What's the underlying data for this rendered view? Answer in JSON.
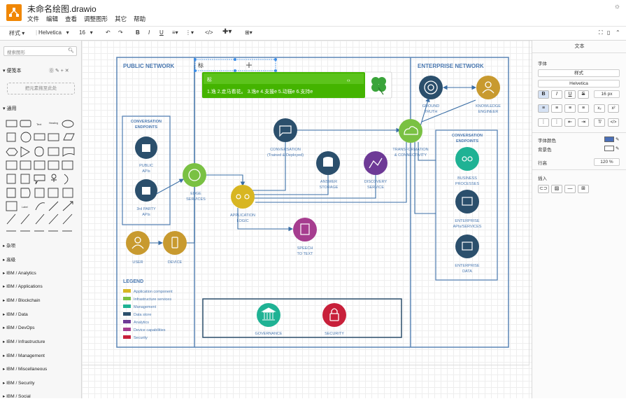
{
  "window": {
    "title": "未命名绘图.drawio",
    "menu": [
      "文件",
      "编辑",
      "查看",
      "调整图形",
      "其它",
      "帮助"
    ]
  },
  "toolbar": {
    "style_label": "样式",
    "font": "Helvetica",
    "size": "16"
  },
  "sidebar": {
    "search_placeholder": "搜索图形",
    "scratchpad_title": "便笺本",
    "scratchpad_drop": "把元素拖至此处",
    "general_title": "通用",
    "libraries": [
      "杂项",
      "高级",
      "IBM / Analytics",
      "IBM / Applications",
      "IBM / Blockchain",
      "IBM / Data",
      "IBM / DevOps",
      "IBM / Infrastructure",
      "IBM / Management",
      "IBM / Miscellaneous",
      "IBM / Security",
      "IBM / Social"
    ]
  },
  "diagram": {
    "public_network": "PUBLIC NETWORK",
    "enterprise_network": "ENTERPRISE NETWORK",
    "editing_text": "标",
    "tooltip_head": "标",
    "tooltip_body": "1.逸 2.走马看花。 3.逸e 4.支援e 5.动猫e 6.支持e",
    "conv_endpoints": [
      "CONVERSATION",
      "ENDPOINTS"
    ],
    "public_apis": [
      "PUBLIC",
      "APIs"
    ],
    "third_party_apis": [
      "3rd PARTY",
      "APIs"
    ],
    "edge_services": [
      "EDGE",
      "SERVICES"
    ],
    "user": "USER",
    "device": "DEVICE",
    "conversation": [
      "CONVERSATION",
      "(Trained & Deployed)"
    ],
    "answer_storage": [
      "ANSWER",
      "STORAGE"
    ],
    "discovery_service": [
      "DISCOVERY",
      "SERVICE"
    ],
    "application_logic": [
      "APPLICATION",
      "LOGIC"
    ],
    "speech_to_text": [
      "SPEECH",
      "TO TEXT"
    ],
    "transformation": [
      "TRANSFORMATION",
      "& CONNECTIVITY"
    ],
    "ground_truth": [
      "GROUND",
      "TRUTH"
    ],
    "knowledge_engineer": [
      "KNOWLEDGE",
      "ENGINEER"
    ],
    "ent_conv_endpoints": [
      "CONVERSATION",
      "ENDPOINTS"
    ],
    "business_processes": [
      "BUSINESS",
      "PROCESSES"
    ],
    "enterprise_apis": [
      "ENTERPRISE",
      "APIs/SERVICES"
    ],
    "enterprise_data": [
      "ENTERPRISE",
      "DATA"
    ],
    "governance": "GOVERNANCE",
    "security": "SECURITY",
    "legend_title": "LEGEND",
    "legend": [
      {
        "label": "Application component",
        "color": "#d8b622"
      },
      {
        "label": "Infrastructure services",
        "color": "#7ac143"
      },
      {
        "label": "Management",
        "color": "#1fb294"
      },
      {
        "label": "Data store",
        "color": "#2b4f6c"
      },
      {
        "label": "Analytics",
        "color": "#6e3a96"
      },
      {
        "label": "Device capabilities",
        "color": "#a63d8f"
      },
      {
        "label": "Security",
        "color": "#c8203a"
      }
    ]
  },
  "right_panel": {
    "tab": "文本",
    "font_label": "字体",
    "style_select": "样式",
    "font_select": "Helvetica",
    "font_size": "16 px",
    "font_color_label": "字体颜色",
    "bg_color_label": "背景色",
    "line_height_label": "行高",
    "line_height": "120 %",
    "insert_label": "插入"
  }
}
